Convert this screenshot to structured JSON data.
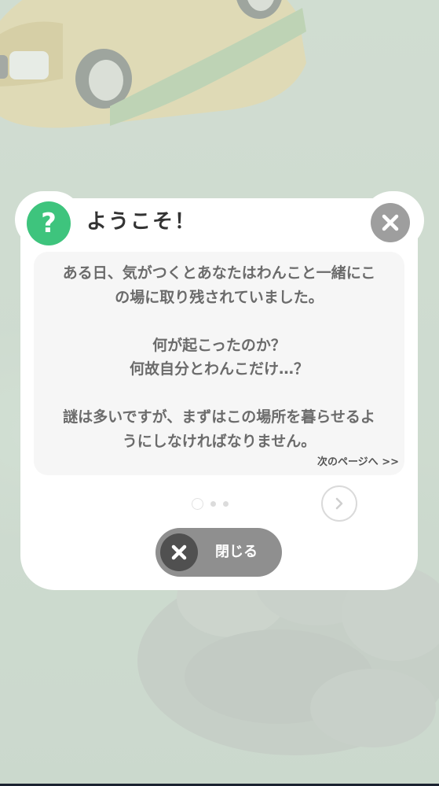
{
  "dialog": {
    "title": "ようこそ！",
    "help_icon_glyph": "?",
    "message": "ある日、気がつくとあなたはわんこと一緒にこ\nの場に取り残されていました。\n\n何が起こったのか？\n何故自分とわんこだけ…？\n\n謎は多いですが、まずはこの場所を暮らせるよ\nうにしなければなりません。",
    "next_page_link": "次のページへ >>",
    "pagination": {
      "current_page": 1,
      "total_pages": 3
    },
    "close_button_label": "閉じる"
  },
  "icons": [
    "help-icon",
    "close-icon",
    "chevron-right-icon"
  ],
  "colors": {
    "help_icon": "#3ec47d",
    "close_icon_bg": "#9e9e9e",
    "close_button_bg": "#8f8f8f",
    "text": "#6b6b6b",
    "title": "#333333"
  }
}
